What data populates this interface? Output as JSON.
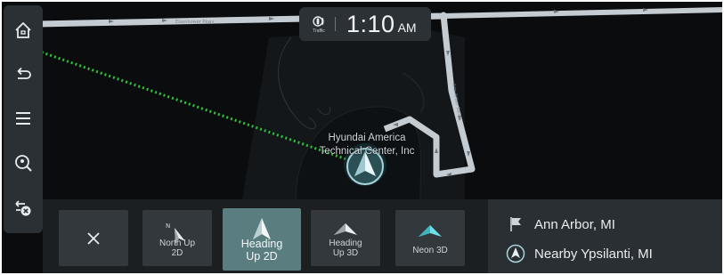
{
  "clock": {
    "traffic_icon": "traffic-icon",
    "traffic_label": "Traffic",
    "time": "1:10",
    "ampm": "AM"
  },
  "map": {
    "poi_line1": "Hyundai America",
    "poi_line2": "Technical Center, Inc",
    "route_color": "#2fbf3a",
    "road_color": "#c4ccd2"
  },
  "rail": {
    "items": [
      {
        "name": "home-icon"
      },
      {
        "name": "back-icon"
      },
      {
        "name": "menu-icon"
      },
      {
        "name": "search-location-icon"
      },
      {
        "name": "cancel-route-icon"
      }
    ]
  },
  "view_options": {
    "close_icon": "close-icon",
    "items": [
      {
        "label_line1": "North Up",
        "label_line2": "2D",
        "north_mark": "N",
        "active": false
      },
      {
        "label_line1": "Heading",
        "label_line2": "Up 2D",
        "active": true
      },
      {
        "label_line1": "Heading",
        "label_line2": "Up 3D",
        "active": false
      },
      {
        "label_line1": "Neon 3D",
        "label_line2": "",
        "active": false
      }
    ]
  },
  "destination": {
    "city": "Ann Arbor, MI",
    "nearby": "Nearby Ypsilanti, MI"
  },
  "colors": {
    "accent_active": "#5a7e80",
    "panel": "#2b3034",
    "background": "#0a0c0e"
  }
}
